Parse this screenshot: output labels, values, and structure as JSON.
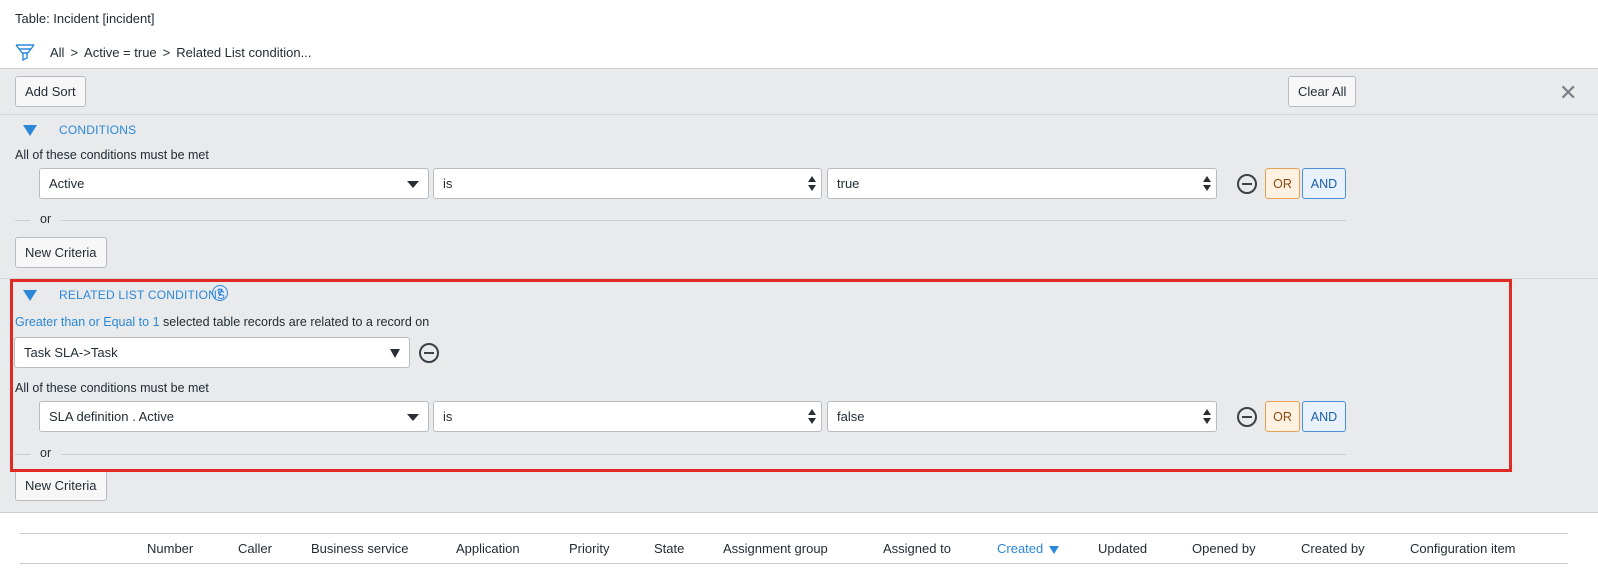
{
  "header": {
    "table_title": "Table: Incident [incident]",
    "breadcrumb": [
      "All",
      "Active = true",
      "Related List condition..."
    ],
    "breadcrumb_sep": ">"
  },
  "toolbar": {
    "add_sort_label": "Add Sort",
    "clear_all_label": "Clear All",
    "close_glyph": "✕"
  },
  "conditions": {
    "heading": "CONDITIONS",
    "all_met_label": "All of these conditions must be met",
    "row": {
      "field": "Active",
      "operator": "is",
      "value": "true"
    },
    "or_label": "or",
    "or_button": "OR",
    "and_button": "AND",
    "new_criteria_label": "New Criteria"
  },
  "related_list": {
    "heading": "RELATED LIST CONDITIONS",
    "help_glyph": "?",
    "quantity_link": "Greater than or Equal to 1",
    "quantity_suffix": "selected table records are related to a record on",
    "relationship": "Task SLA->Task",
    "all_met_label": "All of these conditions must be met",
    "row": {
      "field": "SLA definition . Active",
      "operator": "is",
      "value": "false"
    },
    "or_label": "or",
    "or_button": "OR",
    "and_button": "AND",
    "new_criteria_label": "New Criteria"
  },
  "columns": [
    "Number",
    "Caller",
    "Business service",
    "Application",
    "Priority",
    "State",
    "Assignment group",
    "Assigned to",
    "Created",
    "Updated",
    "Opened by",
    "Created by",
    "Configuration item"
  ],
  "sorted_column": "Created",
  "colors": {
    "accent": "#2b88d8",
    "highlight": "#e02a24",
    "or_bg": "#fff1e1",
    "and_bg": "#e8f1fc",
    "panel_bg": "#e9eaec"
  }
}
